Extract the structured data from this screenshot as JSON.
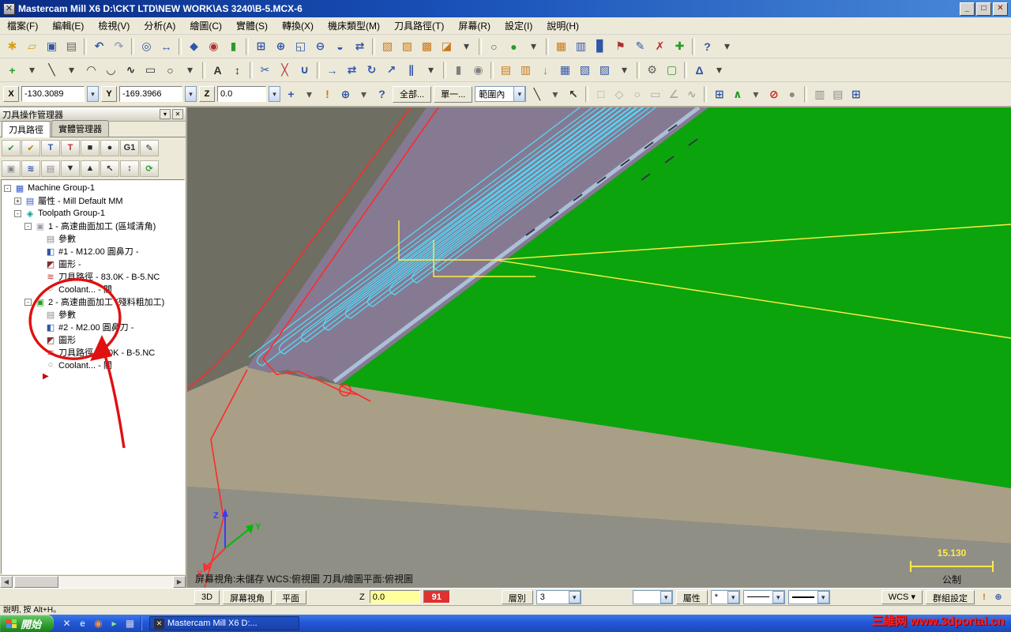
{
  "window": {
    "icon": "✕",
    "title": "Mastercam Mill X6  D:\\CKT LTD\\NEW WORK\\AS 3240\\B-5.MCX-6",
    "minimize": "_",
    "maximize": "□",
    "close": "✕"
  },
  "ui": {
    "chevron": "▾",
    "hscroll_left": "◀",
    "hscroll_right": "▶"
  },
  "menubar": [
    "檔案(F)",
    "編輯(E)",
    "檢視(V)",
    "分析(A)",
    "繪圖(C)",
    "實體(S)",
    "轉換(X)",
    "機床類型(M)",
    "刀具路徑(T)",
    "屏幕(R)",
    "設定(I)",
    "說明(H)"
  ],
  "toolbars": {
    "row1": [
      {
        "n": "file-new",
        "g": "✱",
        "c": "#d4a017"
      },
      {
        "n": "file-open",
        "g": "▱",
        "c": "#d4a017"
      },
      {
        "n": "file-save",
        "g": "▣",
        "c": "#3056a8"
      },
      {
        "n": "print",
        "g": "▤",
        "c": "#606060"
      },
      {
        "n": "separator"
      },
      {
        "n": "undo",
        "g": "↶",
        "c": "#3056a8"
      },
      {
        "n": "redo",
        "g": "↷",
        "c": "#98a2b8"
      },
      {
        "n": "separator"
      },
      {
        "n": "analyze-entity",
        "g": "◎",
        "c": "#3056a8"
      },
      {
        "n": "analyze-distance",
        "g": "↔",
        "c": "#3056a8"
      },
      {
        "n": "separator"
      },
      {
        "n": "dynamic-gnomon",
        "g": "◆",
        "c": "#3056a8"
      },
      {
        "n": "repaint",
        "g": "◉",
        "c": "#b03030"
      },
      {
        "n": "stock-display",
        "g": "▮",
        "c": "#2a9a2a"
      },
      {
        "n": "separator"
      },
      {
        "n": "zoom-window",
        "g": "⊞",
        "c": "#3056a8"
      },
      {
        "n": "zoom-target",
        "g": "⊕",
        "c": "#3056a8"
      },
      {
        "n": "zoom-fit",
        "g": "◱",
        "c": "#3056a8"
      },
      {
        "n": "zoom-out",
        "g": "⊖",
        "c": "#3056a8"
      },
      {
        "n": "zoom-previous",
        "g": "◒",
        "c": "#3056a8"
      },
      {
        "n": "pan",
        "g": "⇄",
        "c": "#3056a8"
      },
      {
        "n": "separator"
      },
      {
        "n": "gview-top",
        "g": "▧",
        "c": "#c87818"
      },
      {
        "n": "gview-front",
        "g": "▨",
        "c": "#c87818"
      },
      {
        "n": "gview-right",
        "g": "▩",
        "c": "#c87818"
      },
      {
        "n": "gview-isometric",
        "g": "◪",
        "c": "#c87818"
      },
      {
        "n": "gview-menu",
        "g": "▾",
        "c": "#444444"
      },
      {
        "n": "separator"
      },
      {
        "n": "shading-off",
        "g": "○",
        "c": "#3056a8"
      },
      {
        "n": "shading-on",
        "g": "●",
        "c": "#2a9a2a"
      },
      {
        "n": "shading-menu",
        "g": "▾",
        "c": "#444444"
      },
      {
        "n": "separator"
      },
      {
        "n": "grid-settings",
        "g": "▦",
        "c": "#c87818"
      },
      {
        "n": "viewsheets",
        "g": "▥",
        "c": "#3056a8"
      },
      {
        "n": "histogram",
        "g": "▊",
        "c": "#3056a8"
      },
      {
        "n": "flag",
        "g": "⚑",
        "c": "#b03030"
      },
      {
        "n": "edit-entity",
        "g": "✎",
        "c": "#3056a8"
      },
      {
        "n": "delete-entities",
        "g": "✗",
        "c": "#b03030"
      },
      {
        "n": "undelete",
        "g": "✚",
        "c": "#2a9a2a"
      },
      {
        "n": "separator"
      },
      {
        "n": "help",
        "g": "?",
        "c": "#3056a8"
      },
      {
        "n": "help-menu",
        "g": "▾",
        "c": "#444444"
      }
    ],
    "row2": [
      {
        "n": "create-point",
        "g": "+",
        "c": "#2a9a2a"
      },
      {
        "n": "create-point-menu",
        "g": "▾",
        "c": "#444444"
      },
      {
        "n": "create-line",
        "g": "╲",
        "c": "#303030"
      },
      {
        "n": "create-line-menu",
        "g": "▾",
        "c": "#444444"
      },
      {
        "n": "create-arc",
        "g": "◠",
        "c": "#303030"
      },
      {
        "n": "create-fillet",
        "g": "◡",
        "c": "#303030"
      },
      {
        "n": "create-spline",
        "g": "∿",
        "c": "#303030"
      },
      {
        "n": "create-rectangle",
        "g": "▭",
        "c": "#303030"
      },
      {
        "n": "create-circle",
        "g": "○",
        "c": "#303030"
      },
      {
        "n": "create-menu",
        "g": "▾",
        "c": "#444444"
      },
      {
        "n": "separator"
      },
      {
        "n": "create-letters",
        "g": "A",
        "c": "#303030"
      },
      {
        "n": "dimension",
        "g": "↕",
        "c": "#303030"
      },
      {
        "n": "separator"
      },
      {
        "n": "trim-break",
        "g": "✂",
        "c": "#3056a8"
      },
      {
        "n": "break-pieces",
        "g": "╳",
        "c": "#b03030"
      },
      {
        "n": "join-entities",
        "g": "∪",
        "c": "#3056a8"
      },
      {
        "n": "separator"
      },
      {
        "n": "xform-translate",
        "g": "→",
        "c": "#3056a8"
      },
      {
        "n": "xform-mirror",
        "g": "⇄",
        "c": "#3056a8"
      },
      {
        "n": "xform-rotate",
        "g": "↻",
        "c": "#3056a8"
      },
      {
        "n": "xform-scale",
        "g": "↗",
        "c": "#3056a8"
      },
      {
        "n": "xform-offset",
        "g": "∥",
        "c": "#3056a8"
      },
      {
        "n": "xform-menu",
        "g": "▾",
        "c": "#444444"
      },
      {
        "n": "separator"
      },
      {
        "n": "solids-extrude",
        "g": "▮",
        "c": "#808080"
      },
      {
        "n": "solids-revolve",
        "g": "◉",
        "c": "#808080"
      },
      {
        "n": "separator"
      },
      {
        "n": "toolpath-contour",
        "g": "▤",
        "c": "#c87818"
      },
      {
        "n": "toolpath-pocket",
        "g": "▥",
        "c": "#c87818"
      },
      {
        "n": "toolpath-drill",
        "g": "↓",
        "c": "#c87818"
      },
      {
        "n": "toolpath-face",
        "g": "▦",
        "c": "#3056a8"
      },
      {
        "n": "toolpath-surface-rough",
        "g": "▧",
        "c": "#3056a8"
      },
      {
        "n": "toolpath-surface-finish",
        "g": "▨",
        "c": "#3056a8"
      },
      {
        "n": "toolpath-menu",
        "g": "▾",
        "c": "#444444"
      },
      {
        "n": "separator"
      },
      {
        "n": "machine-settings",
        "g": "⚙",
        "c": "#606060"
      },
      {
        "n": "material-setup",
        "g": "▢",
        "c": "#2a9a2a"
      },
      {
        "n": "separator"
      },
      {
        "n": "plane-select",
        "g": "Δ",
        "c": "#3056a8"
      },
      {
        "n": "plane-menu",
        "g": "▾",
        "c": "#444444"
      }
    ]
  },
  "ribbon": {
    "x_label": "X",
    "x_value": "-130.3089",
    "y_label": "Y",
    "y_value": "-169.3966",
    "z_label": "Z",
    "z_value": "0.0",
    "icons_left": [
      {
        "n": "fastpoint",
        "g": "+",
        "c": "#3056a8"
      },
      {
        "n": "fastpoint-menu",
        "g": "▾",
        "c": "#555555"
      },
      {
        "n": "cursor-warning",
        "g": "!",
        "c": "#c08000"
      },
      {
        "n": "cursor-origin",
        "g": "⊕",
        "c": "#3056a8"
      },
      {
        "n": "cursor-menu",
        "g": "▾",
        "c": "#555555"
      },
      {
        "n": "cursor-help",
        "g": "?",
        "c": "#3056a8"
      }
    ],
    "btn_all": "全部...",
    "btn_single": "單一...",
    "range_combo": "範圍內",
    "icons_right": [
      {
        "n": "style-line",
        "g": "╲",
        "c": "#303030"
      },
      {
        "n": "style-menu",
        "g": "▾",
        "c": "#555555"
      },
      {
        "n": "select-cursor",
        "g": "↖",
        "c": "#303030"
      },
      {
        "n": "separator"
      },
      {
        "n": "sel-point-mode",
        "g": "□",
        "c": "#a8a8a8"
      },
      {
        "n": "sel-line-mode",
        "g": "◇",
        "c": "#a8a8a8"
      },
      {
        "n": "sel-arc-mode",
        "g": "○",
        "c": "#a8a8a8"
      },
      {
        "n": "sel-surface-mode",
        "g": "▭",
        "c": "#a8a8a8"
      },
      {
        "n": "sel-angle-mode",
        "g": "∠",
        "c": "#a8a8a8"
      },
      {
        "n": "sel-spline-mode",
        "g": "∿",
        "c": "#a8a8a8"
      },
      {
        "n": "separator"
      },
      {
        "n": "window-select",
        "g": "⊞",
        "c": "#3056a8"
      },
      {
        "n": "polygon-select",
        "g": "∧",
        "c": "#2a9a2a"
      },
      {
        "n": "select-mode-menu",
        "g": "▾",
        "c": "#555555"
      },
      {
        "n": "clear-selection",
        "g": "⊘",
        "c": "#cc2020"
      },
      {
        "n": "end-selection",
        "g": "●",
        "c": "#8a8a8a"
      },
      {
        "n": "separator"
      },
      {
        "n": "grid-toggle",
        "g": "▥",
        "c": "#8a8a8a"
      },
      {
        "n": "guide-toggle",
        "g": "▤",
        "c": "#8a8a8a"
      },
      {
        "n": "snap-settings",
        "g": "⊞",
        "c": "#3056a8"
      }
    ]
  },
  "panel": {
    "title": "刀具操作管理器",
    "header_icons": [
      {
        "n": "panel-menu-icon",
        "g": "▾"
      },
      {
        "n": "panel-close-icon",
        "g": "✕"
      }
    ],
    "tabs": [
      {
        "label": "刀具路徑",
        "cls": "ptab active",
        "nm": "tab-toolpaths"
      },
      {
        "label": "實體管理器",
        "cls": "ptab",
        "nm": "tab-solids"
      }
    ],
    "toolbar1": [
      {
        "n": "select-all-operations",
        "g": "✔",
        "c": "#2a9a2a"
      },
      {
        "n": "select-dirty-operations",
        "g": "✔",
        "c": "#c08000"
      },
      {
        "n": "regen-selected",
        "g": "T",
        "c": "#3056a8"
      },
      {
        "n": "regen-dirty",
        "g": "T",
        "c": "#c03030"
      },
      {
        "n": "backplot",
        "g": "■",
        "c": "#303030"
      },
      {
        "n": "verify",
        "g": "●",
        "c": "#303030"
      },
      {
        "n": "post-g1",
        "g": "G1",
        "c": "#303030"
      },
      {
        "n": "edit-operations",
        "g": "✎",
        "c": "#303030"
      }
    ],
    "toolbar2": [
      {
        "n": "lock-toolpath",
        "g": "▣",
        "c": "#8a8a8a"
      },
      {
        "n": "toggle-toolpath-display",
        "g": "≋",
        "c": "#3056a8"
      },
      {
        "n": "toggle-posting",
        "g": "▤",
        "c": "#8a8a8a"
      },
      {
        "n": "move-down",
        "g": "▼",
        "c": "#303030"
      },
      {
        "n": "move-up",
        "g": "▲",
        "c": "#303030"
      },
      {
        "n": "move-insert",
        "g": "↖",
        "c": "#303030"
      },
      {
        "n": "scroll-operations",
        "g": "↕",
        "c": "#303030"
      },
      {
        "n": "refresh-tree",
        "g": "⟳",
        "c": "#2a9a2a"
      }
    ],
    "tree": [
      {
        "depth": "0",
        "exp": "-",
        "icon": "machine-group",
        "label": "Machine Group-1"
      },
      {
        "depth": "1",
        "exp": "+",
        "icon": "properties",
        "label": "屬性 - Mill Default MM"
      },
      {
        "depth": "1",
        "exp": "-",
        "icon": "toolpath-group",
        "label": "Toolpath Group-1"
      },
      {
        "depth": "2",
        "exp": "-",
        "icon": "operation",
        "label": "1 - 高速曲面加工 (區域清角)"
      },
      {
        "depth": "3",
        "icon": "parameters",
        "label": "參數"
      },
      {
        "depth": "3",
        "icon": "tool",
        "label": "#1 - M12.00 圓鼻刀 -"
      },
      {
        "depth": "3",
        "icon": "geometry",
        "label": "圖形 -"
      },
      {
        "depth": "3",
        "icon": "toolpath-file",
        "label": "刀具路徑 - 83.0K - B-5.NC"
      },
      {
        "depth": "3",
        "icon": "coolant",
        "label": "Coolant... - 關"
      },
      {
        "depth": "2",
        "exp": "-",
        "icon": "operation-selected",
        "label": "2 - 高速曲面加工 (殘料粗加工)"
      },
      {
        "depth": "3",
        "icon": "parameters",
        "label": "參數"
      },
      {
        "depth": "3",
        "icon": "tool",
        "label": "#2 - M2.00 圓鼻刀 -"
      },
      {
        "depth": "3",
        "icon": "geometry",
        "label": "圖形"
      },
      {
        "depth": "3",
        "icon": "toolpath-file",
        "label": "刀具路徑 - 0.0K - B-5.NC"
      },
      {
        "depth": "3",
        "icon": "coolant",
        "label": "Coolant... - 關"
      }
    ],
    "insert_marker": "▶"
  },
  "viewport": {
    "status": "屏幕視角:未儲存   WCS:俯視圖   刀具/繪圖平面:俯視圖",
    "scale_value": "15.130",
    "scale_unit": "公制",
    "axis_x": "X",
    "axis_y": "Y",
    "axis_z": "Z",
    "colors": {
      "background": "#6e6e63",
      "surface_green": "#0ca40c",
      "surface_tan": "#a89f86",
      "surface_gray": "#8f8f85",
      "band_purple": "#857a92",
      "toolpath_cyan": "#55d8f8",
      "highlight_yellow": "#ffee44",
      "outline_red": "#ff2a2a",
      "annotation_red": "#e01010"
    }
  },
  "statusbar": {
    "btn_3d": "3D",
    "btn_gview": "屏幕視角",
    "btn_planes": "平面",
    "z_label": "Z",
    "z_value": "0.0",
    "color_value": "91",
    "level_label": "層別",
    "level_value": "3",
    "attr_label": "屬性",
    "star": "*",
    "wcs_label": "WCS",
    "groups_label": "群組設定",
    "icons_right": [
      {
        "n": "alert-icon",
        "g": "!",
        "c": "#c08000"
      },
      {
        "n": "origin-target-icon",
        "g": "⊕",
        "c": "#3056a8"
      }
    ]
  },
  "hintbar": {
    "text": "說明, 按 Alt+H。"
  },
  "taskbar": {
    "start_label": "開始",
    "quicklaunch": [
      {
        "n": "quicklaunch-mastercam",
        "g": "✕",
        "c": "#f0f0f0"
      },
      {
        "n": "quicklaunch-ie",
        "g": "e",
        "c": "#bcd8ff"
      },
      {
        "n": "quicklaunch-firefox",
        "g": "◉",
        "c": "#ff9030"
      },
      {
        "n": "quicklaunch-media",
        "g": "▸",
        "c": "#8ce88c"
      },
      {
        "n": "quicklaunch-desktop",
        "g": "▦",
        "c": "#d0d0f0"
      }
    ],
    "task_icon": "✕",
    "task_label": "Mastercam Mill X6  D:..."
  },
  "watermark": "三維网 www.3dportal.cn"
}
